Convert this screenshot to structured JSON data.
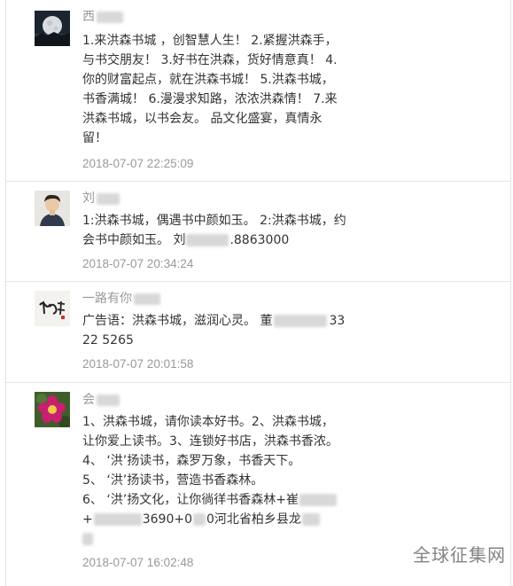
{
  "comments": [
    {
      "name": "西",
      "avatar_icon": "moon-night-avatar",
      "content_lines": [
        "1.来洪森书城 ，创智慧人生！ 2.紧握洪森手，",
        "与书交朋友！ 3.好书在洪森，货好情意真！ 4.",
        "你的财富起点，就在洪森书城！ 5.洪森书城，",
        "书香满城！ 6.漫漫求知路，浓浓洪森情！ 7.来",
        "洪森书城，以书会友。 品文化盛宴，真情永",
        "留！"
      ],
      "time": "2018-07-07 22:25:09"
    },
    {
      "name": "刘",
      "avatar_icon": "person-portrait-avatar",
      "content_lines": [
        "1:洪森书城，偶遇书中颜如玉。 2:洪森书城，约",
        "会书中颜如玉。 刘"
      ],
      "content_tail": ".8863000",
      "time": "2018-07-07 20:34:24"
    },
    {
      "name": "一路有你",
      "avatar_icon": "calligraphy-avatar",
      "content_lines": [
        "广告语：洪森书城，滋润心灵。 董",
        "22 5265"
      ],
      "content_tail": "33",
      "time": "2018-07-07 20:01:58"
    },
    {
      "name": "会",
      "avatar_icon": "flower-avatar",
      "content_lines": [
        "1、洪森书城，请你读本好书。2、洪森书城，",
        "让你爱上读书。3、连锁好书店，洪森书香浓。",
        "4、 ‘洪’扬读书，森罗万象，书香天下。",
        "5、 ‘洪’扬读书，营造书香森林。",
        "6、 ‘洪’扬文化，让你徜徉书香森林+崔",
        "+",
        ""
      ],
      "content_mid": "3690+0",
      "content_tail": "0河北省柏乡县龙",
      "time": "2018-07-07 16:02:48"
    }
  ],
  "watermark": "全球征集网"
}
